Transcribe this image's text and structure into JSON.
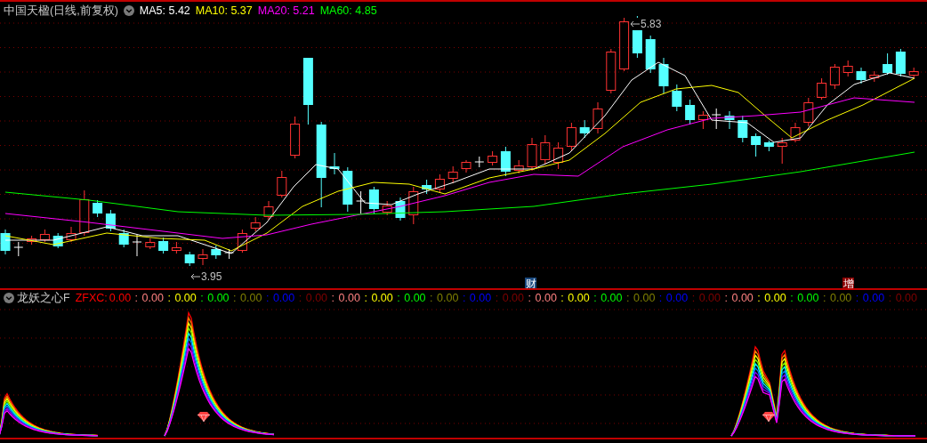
{
  "main_panel": {
    "title": "中国天楹(日线,前复权)",
    "moving_averages": [
      {
        "label": "MA5: 5.42",
        "color": "#ffffff"
      },
      {
        "label": "MA10: 5.37",
        "color": "#ffff00"
      },
      {
        "label": "MA20: 5.21",
        "color": "#ff00ff"
      },
      {
        "label": "MA60: 4.85",
        "color": "#00ff00"
      }
    ],
    "price_labels": [
      {
        "kind": "high",
        "text": "5.83"
      },
      {
        "kind": "low",
        "text": "3.95"
      }
    ],
    "event_markers": [
      {
        "text": "财",
        "color": "#1a4a80"
      },
      {
        "text": "增",
        "color": "#8b0000"
      }
    ]
  },
  "indicator_panel": {
    "title": "龙妖之心F",
    "series_label": "ZFXC:",
    "values": [
      {
        "value": "0.00",
        "color": "#ff0000"
      },
      {
        "separator": ":",
        "value": "0.00",
        "color": "#ff8080"
      },
      {
        "separator": ":",
        "value": "0.00",
        "color": "#ffff00"
      },
      {
        "separator": ":",
        "value": "0.00",
        "color": "#00ff00"
      },
      {
        "separator": ":",
        "value": "0.00",
        "color": "#808000"
      },
      {
        "separator": ":",
        "value": "0.00",
        "color": "#0000ff"
      },
      {
        "separator": ":",
        "value": "0.00",
        "color": "#800000"
      },
      {
        "separator": ":",
        "value": "0.00",
        "color": "#ff8080"
      },
      {
        "separator": ":",
        "value": "0.00",
        "color": "#ffff00"
      },
      {
        "separator": ":",
        "value": "0.00",
        "color": "#00ff00"
      },
      {
        "separator": ":",
        "value": "0.00",
        "color": "#808000"
      },
      {
        "separator": ":",
        "value": "0.00",
        "color": "#0000ff"
      },
      {
        "separator": ":",
        "value": "0.00",
        "color": "#800000"
      },
      {
        "separator": ":",
        "value": "0.00",
        "color": "#ff8080"
      },
      {
        "separator": ":",
        "value": "0.00",
        "color": "#ffff00"
      },
      {
        "separator": ":",
        "value": "0.00",
        "color": "#00ff00"
      },
      {
        "separator": ":",
        "value": "0.00",
        "color": "#808000"
      },
      {
        "separator": ":",
        "value": "0.00",
        "color": "#0000ff"
      },
      {
        "separator": ":",
        "value": "0.00",
        "color": "#800000"
      },
      {
        "separator": ":",
        "value": "0.00",
        "color": "#ff8080"
      },
      {
        "separator": ":",
        "value": "0.00",
        "color": "#ffff00"
      },
      {
        "separator": ":",
        "value": "0.00",
        "color": "#00ff00"
      },
      {
        "separator": ":",
        "value": "0.00",
        "color": "#808000"
      },
      {
        "separator": ":",
        "value": "0.00",
        "color": "#0000ff"
      },
      {
        "separator": ":",
        "value": "0.00",
        "color": "#800000"
      }
    ]
  }
}
